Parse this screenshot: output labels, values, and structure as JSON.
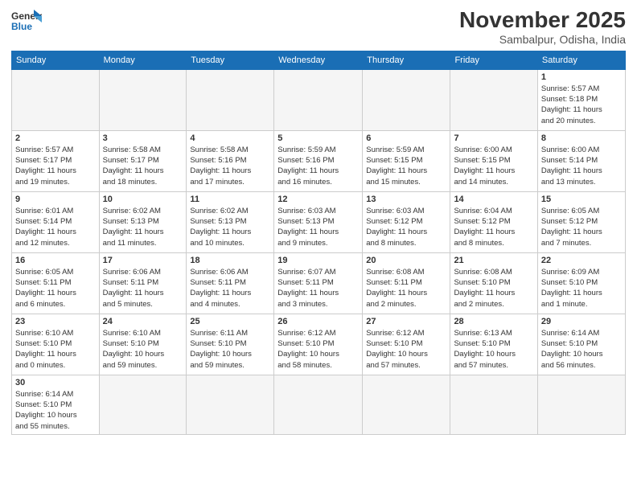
{
  "header": {
    "logo_general": "General",
    "logo_blue": "Blue",
    "month_year": "November 2025",
    "location": "Sambalpur, Odisha, India"
  },
  "weekdays": [
    "Sunday",
    "Monday",
    "Tuesday",
    "Wednesday",
    "Thursday",
    "Friday",
    "Saturday"
  ],
  "weeks": [
    [
      {
        "day": "",
        "info": "",
        "empty": true
      },
      {
        "day": "",
        "info": "",
        "empty": true
      },
      {
        "day": "",
        "info": "",
        "empty": true
      },
      {
        "day": "",
        "info": "",
        "empty": true
      },
      {
        "day": "",
        "info": "",
        "empty": true
      },
      {
        "day": "",
        "info": "",
        "empty": true
      },
      {
        "day": "1",
        "info": "Sunrise: 5:57 AM\nSunset: 5:18 PM\nDaylight: 11 hours\nand 20 minutes.",
        "empty": false
      }
    ],
    [
      {
        "day": "2",
        "info": "Sunrise: 5:57 AM\nSunset: 5:17 PM\nDaylight: 11 hours\nand 19 minutes.",
        "empty": false
      },
      {
        "day": "3",
        "info": "Sunrise: 5:58 AM\nSunset: 5:17 PM\nDaylight: 11 hours\nand 18 minutes.",
        "empty": false
      },
      {
        "day": "4",
        "info": "Sunrise: 5:58 AM\nSunset: 5:16 PM\nDaylight: 11 hours\nand 17 minutes.",
        "empty": false
      },
      {
        "day": "5",
        "info": "Sunrise: 5:59 AM\nSunset: 5:16 PM\nDaylight: 11 hours\nand 16 minutes.",
        "empty": false
      },
      {
        "day": "6",
        "info": "Sunrise: 5:59 AM\nSunset: 5:15 PM\nDaylight: 11 hours\nand 15 minutes.",
        "empty": false
      },
      {
        "day": "7",
        "info": "Sunrise: 6:00 AM\nSunset: 5:15 PM\nDaylight: 11 hours\nand 14 minutes.",
        "empty": false
      },
      {
        "day": "8",
        "info": "Sunrise: 6:00 AM\nSunset: 5:14 PM\nDaylight: 11 hours\nand 13 minutes.",
        "empty": false
      }
    ],
    [
      {
        "day": "9",
        "info": "Sunrise: 6:01 AM\nSunset: 5:14 PM\nDaylight: 11 hours\nand 12 minutes.",
        "empty": false
      },
      {
        "day": "10",
        "info": "Sunrise: 6:02 AM\nSunset: 5:13 PM\nDaylight: 11 hours\nand 11 minutes.",
        "empty": false
      },
      {
        "day": "11",
        "info": "Sunrise: 6:02 AM\nSunset: 5:13 PM\nDaylight: 11 hours\nand 10 minutes.",
        "empty": false
      },
      {
        "day": "12",
        "info": "Sunrise: 6:03 AM\nSunset: 5:13 PM\nDaylight: 11 hours\nand 9 minutes.",
        "empty": false
      },
      {
        "day": "13",
        "info": "Sunrise: 6:03 AM\nSunset: 5:12 PM\nDaylight: 11 hours\nand 8 minutes.",
        "empty": false
      },
      {
        "day": "14",
        "info": "Sunrise: 6:04 AM\nSunset: 5:12 PM\nDaylight: 11 hours\nand 8 minutes.",
        "empty": false
      },
      {
        "day": "15",
        "info": "Sunrise: 6:05 AM\nSunset: 5:12 PM\nDaylight: 11 hours\nand 7 minutes.",
        "empty": false
      }
    ],
    [
      {
        "day": "16",
        "info": "Sunrise: 6:05 AM\nSunset: 5:11 PM\nDaylight: 11 hours\nand 6 minutes.",
        "empty": false
      },
      {
        "day": "17",
        "info": "Sunrise: 6:06 AM\nSunset: 5:11 PM\nDaylight: 11 hours\nand 5 minutes.",
        "empty": false
      },
      {
        "day": "18",
        "info": "Sunrise: 6:06 AM\nSunset: 5:11 PM\nDaylight: 11 hours\nand 4 minutes.",
        "empty": false
      },
      {
        "day": "19",
        "info": "Sunrise: 6:07 AM\nSunset: 5:11 PM\nDaylight: 11 hours\nand 3 minutes.",
        "empty": false
      },
      {
        "day": "20",
        "info": "Sunrise: 6:08 AM\nSunset: 5:11 PM\nDaylight: 11 hours\nand 2 minutes.",
        "empty": false
      },
      {
        "day": "21",
        "info": "Sunrise: 6:08 AM\nSunset: 5:10 PM\nDaylight: 11 hours\nand 2 minutes.",
        "empty": false
      },
      {
        "day": "22",
        "info": "Sunrise: 6:09 AM\nSunset: 5:10 PM\nDaylight: 11 hours\nand 1 minute.",
        "empty": false
      }
    ],
    [
      {
        "day": "23",
        "info": "Sunrise: 6:10 AM\nSunset: 5:10 PM\nDaylight: 11 hours\nand 0 minutes.",
        "empty": false
      },
      {
        "day": "24",
        "info": "Sunrise: 6:10 AM\nSunset: 5:10 PM\nDaylight: 10 hours\nand 59 minutes.",
        "empty": false
      },
      {
        "day": "25",
        "info": "Sunrise: 6:11 AM\nSunset: 5:10 PM\nDaylight: 10 hours\nand 59 minutes.",
        "empty": false
      },
      {
        "day": "26",
        "info": "Sunrise: 6:12 AM\nSunset: 5:10 PM\nDaylight: 10 hours\nand 58 minutes.",
        "empty": false
      },
      {
        "day": "27",
        "info": "Sunrise: 6:12 AM\nSunset: 5:10 PM\nDaylight: 10 hours\nand 57 minutes.",
        "empty": false
      },
      {
        "day": "28",
        "info": "Sunrise: 6:13 AM\nSunset: 5:10 PM\nDaylight: 10 hours\nand 57 minutes.",
        "empty": false
      },
      {
        "day": "29",
        "info": "Sunrise: 6:14 AM\nSunset: 5:10 PM\nDaylight: 10 hours\nand 56 minutes.",
        "empty": false
      }
    ],
    [
      {
        "day": "30",
        "info": "Sunrise: 6:14 AM\nSunset: 5:10 PM\nDaylight: 10 hours\nand 55 minutes.",
        "empty": false
      },
      {
        "day": "",
        "info": "",
        "empty": true
      },
      {
        "day": "",
        "info": "",
        "empty": true
      },
      {
        "day": "",
        "info": "",
        "empty": true
      },
      {
        "day": "",
        "info": "",
        "empty": true
      },
      {
        "day": "",
        "info": "",
        "empty": true
      },
      {
        "day": "",
        "info": "",
        "empty": true
      }
    ]
  ]
}
